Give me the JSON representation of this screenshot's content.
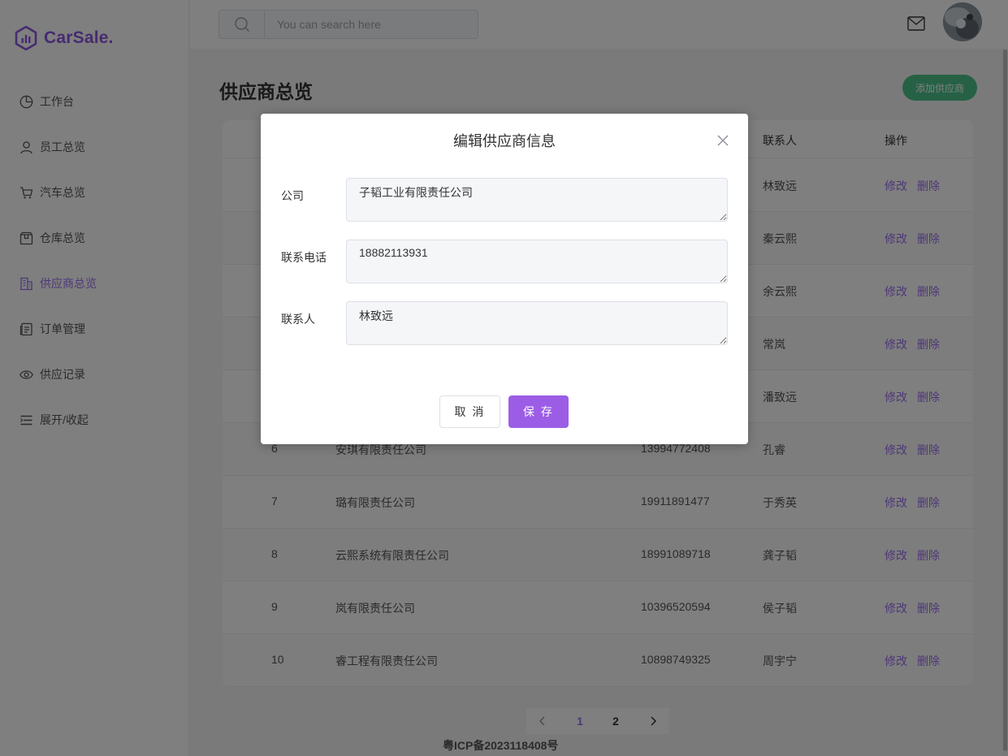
{
  "brand": {
    "name": "CarSale.",
    "color": "#8c56e3"
  },
  "sidebar": {
    "items": [
      {
        "label": "工作台",
        "icon": "pie-chart-icon"
      },
      {
        "label": "员工总览",
        "icon": "user-icon"
      },
      {
        "label": "汽车总览",
        "icon": "cart-icon"
      },
      {
        "label": "仓库总览",
        "icon": "box-icon"
      },
      {
        "label": "供应商总览",
        "icon": "building-icon",
        "active": true
      },
      {
        "label": "订单管理",
        "icon": "document-icon"
      },
      {
        "label": "供应记录",
        "icon": "eye-icon"
      },
      {
        "label": "展开/收起",
        "icon": "menu-icon"
      }
    ]
  },
  "header": {
    "search_placeholder": "You can search here"
  },
  "main": {
    "title": "供应商总览",
    "add_button": "添加供应商",
    "table": {
      "columns": [
        "联系人",
        "操作"
      ],
      "rows": [
        {
          "id": "",
          "company": "",
          "phone": "",
          "contact": "林致远"
        },
        {
          "id": "",
          "company": "",
          "phone": "",
          "contact": "秦云熙"
        },
        {
          "id": "",
          "company": "",
          "phone": "",
          "contact": "余云熙"
        },
        {
          "id": "",
          "company": "",
          "phone": "",
          "contact": "常岚"
        },
        {
          "id": "",
          "company": "",
          "phone": "",
          "contact": "潘致远"
        },
        {
          "id": "6",
          "company": "安琪有限责任公司",
          "phone": "13994772408",
          "contact": "孔睿"
        },
        {
          "id": "7",
          "company": "璐有限责任公司",
          "phone": "19911891477",
          "contact": "于秀英"
        },
        {
          "id": "8",
          "company": "云熙系统有限责任公司",
          "phone": "18991089718",
          "contact": "龚子韬"
        },
        {
          "id": "9",
          "company": "岚有限责任公司",
          "phone": "10396520594",
          "contact": "侯子韬"
        },
        {
          "id": "10",
          "company": "睿工程有限责任公司",
          "phone": "10898749325",
          "contact": "周宇宁"
        }
      ],
      "edit_label": "修改",
      "delete_label": "删除"
    },
    "pagination": {
      "pages": [
        "1",
        "2"
      ],
      "current": "1"
    },
    "footer": "粤ICP备2023118408号"
  },
  "modal": {
    "title": "编辑供应商信息",
    "fields": [
      {
        "label": "公司",
        "value": "子韬工业有限责任公司"
      },
      {
        "label": "联系电话",
        "value": "18882113931"
      },
      {
        "label": "联系人",
        "value": "林致远"
      }
    ],
    "cancel_label": "取 消",
    "save_label": "保 存"
  },
  "colors": {
    "accent": "#9b5de5",
    "add_button": "#4cc38a"
  }
}
